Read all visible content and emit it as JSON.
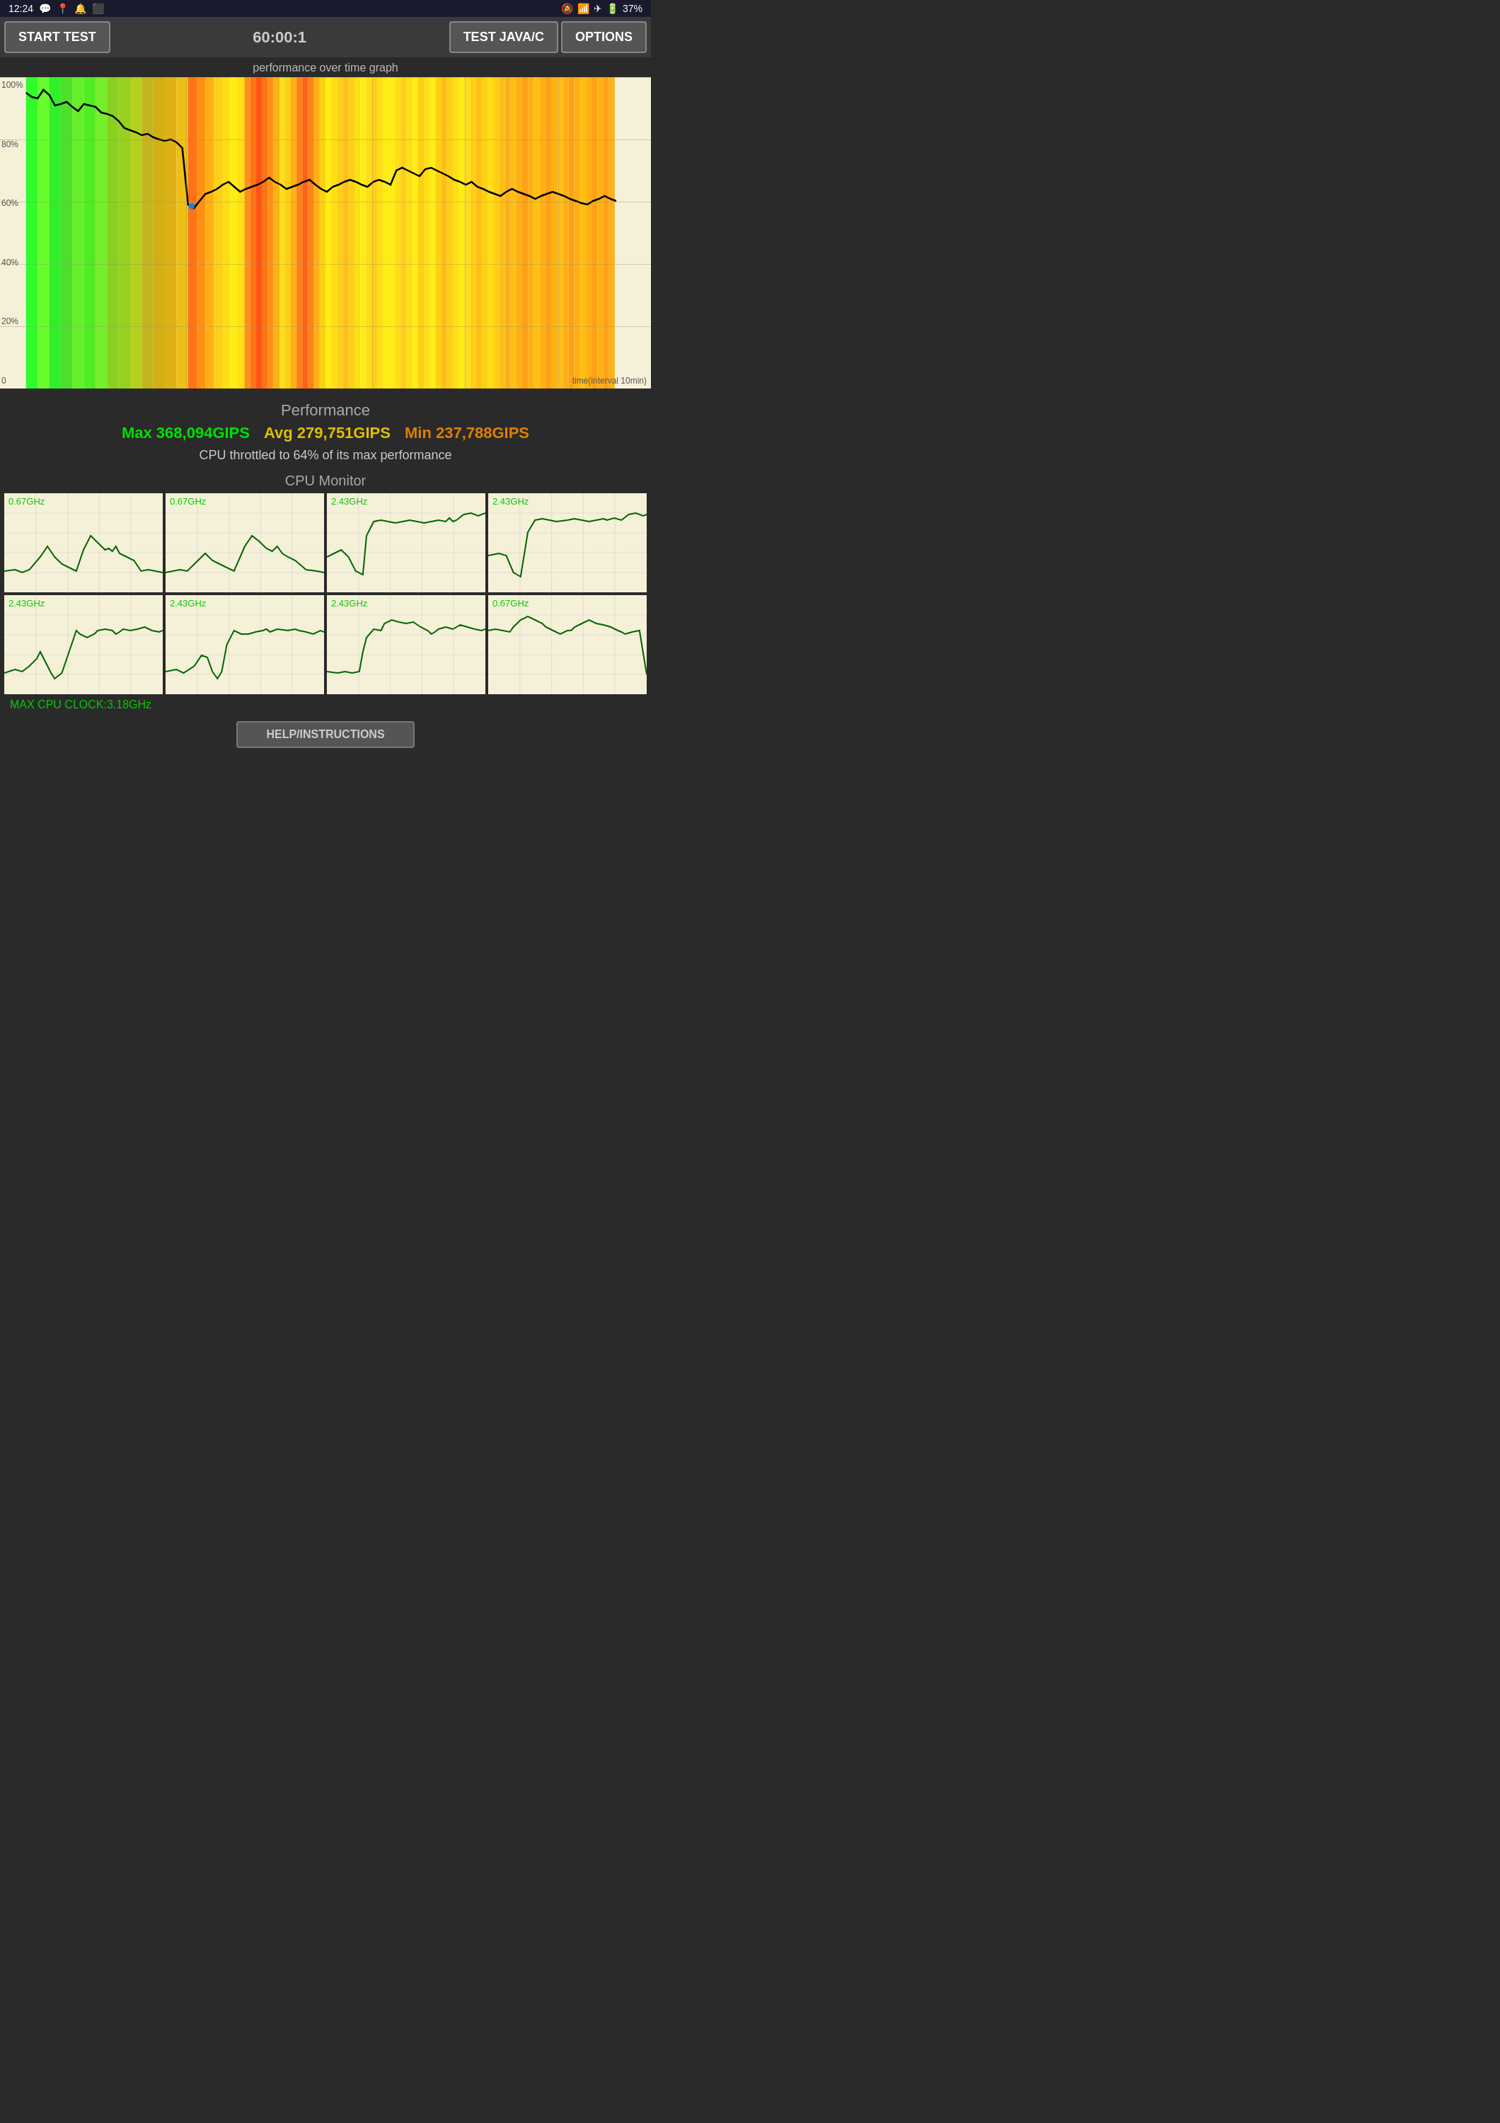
{
  "statusBar": {
    "time": "12:24",
    "icons": [
      "whatsapp",
      "location",
      "notification",
      "screen-record"
    ],
    "rightIcons": [
      "bell-mute",
      "wifi",
      "airplane",
      "battery"
    ],
    "battery": "37%"
  },
  "toolbar": {
    "startTestLabel": "START TEST",
    "timerValue": "60:00:1",
    "testModeLabel": "TEST JAVA/C",
    "optionsLabel": "OPTIONS"
  },
  "graph": {
    "title": "performance over time graph",
    "yLabels": [
      "100%",
      "80%",
      "60%",
      "40%",
      "20%",
      "0"
    ],
    "timeIntervalLabel": "time(interval 10min)"
  },
  "performance": {
    "title": "Performance",
    "max": "Max 368,094GIPS",
    "avg": "Avg 279,751GIPS",
    "min": "Min 237,788GIPS",
    "throttleMsg": "CPU throttled to 64% of its max performance"
  },
  "cpuMonitor": {
    "title": "CPU Monitor",
    "cores": [
      {
        "freq": "0.67GHz"
      },
      {
        "freq": "0.67GHz"
      },
      {
        "freq": "2.43GHz"
      },
      {
        "freq": "2.43GHz"
      },
      {
        "freq": "2.43GHz"
      },
      {
        "freq": "2.43GHz"
      },
      {
        "freq": "2.43GHz"
      },
      {
        "freq": "0.67GHz"
      }
    ],
    "maxClockLabel": "MAX CPU CLOCK:3.18GHz"
  },
  "helpButton": {
    "label": "HELP/INSTRUCTIONS"
  }
}
